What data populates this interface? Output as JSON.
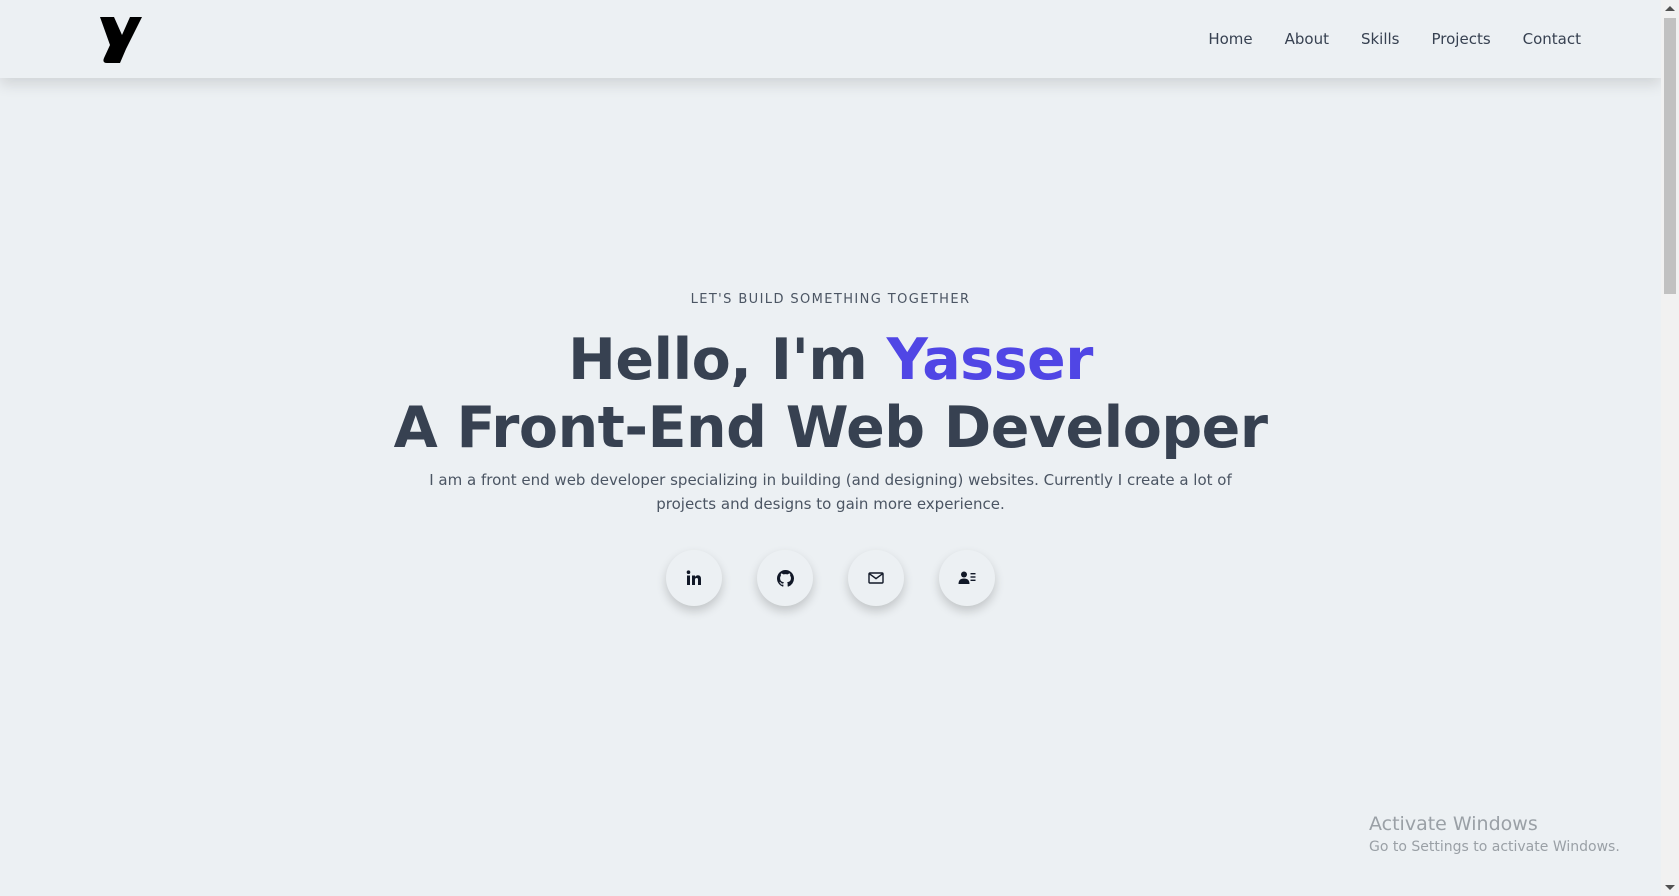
{
  "nav": {
    "logo_icon": "y-logo-icon",
    "links": [
      "Home",
      "About",
      "Skills",
      "Projects",
      "Contact"
    ]
  },
  "hero": {
    "tagline": "LET'S BUILD SOMETHING TOGETHER",
    "greeting": "Hello, I'm ",
    "name": "Yasser",
    "role": "A Front-End Web Developer",
    "description": "I am a front end web developer specializing in building (and designing) websites. Currently I create a lot of projects and designs to gain more experience.",
    "accent_color": "#5046e5",
    "text_color": "#374151"
  },
  "socials": [
    {
      "icon": "linkedin-icon"
    },
    {
      "icon": "github-icon"
    },
    {
      "icon": "mail-icon"
    },
    {
      "icon": "contact-card-icon"
    }
  ],
  "watermark": {
    "title": "Activate Windows",
    "subtitle": "Go to Settings to activate Windows."
  }
}
